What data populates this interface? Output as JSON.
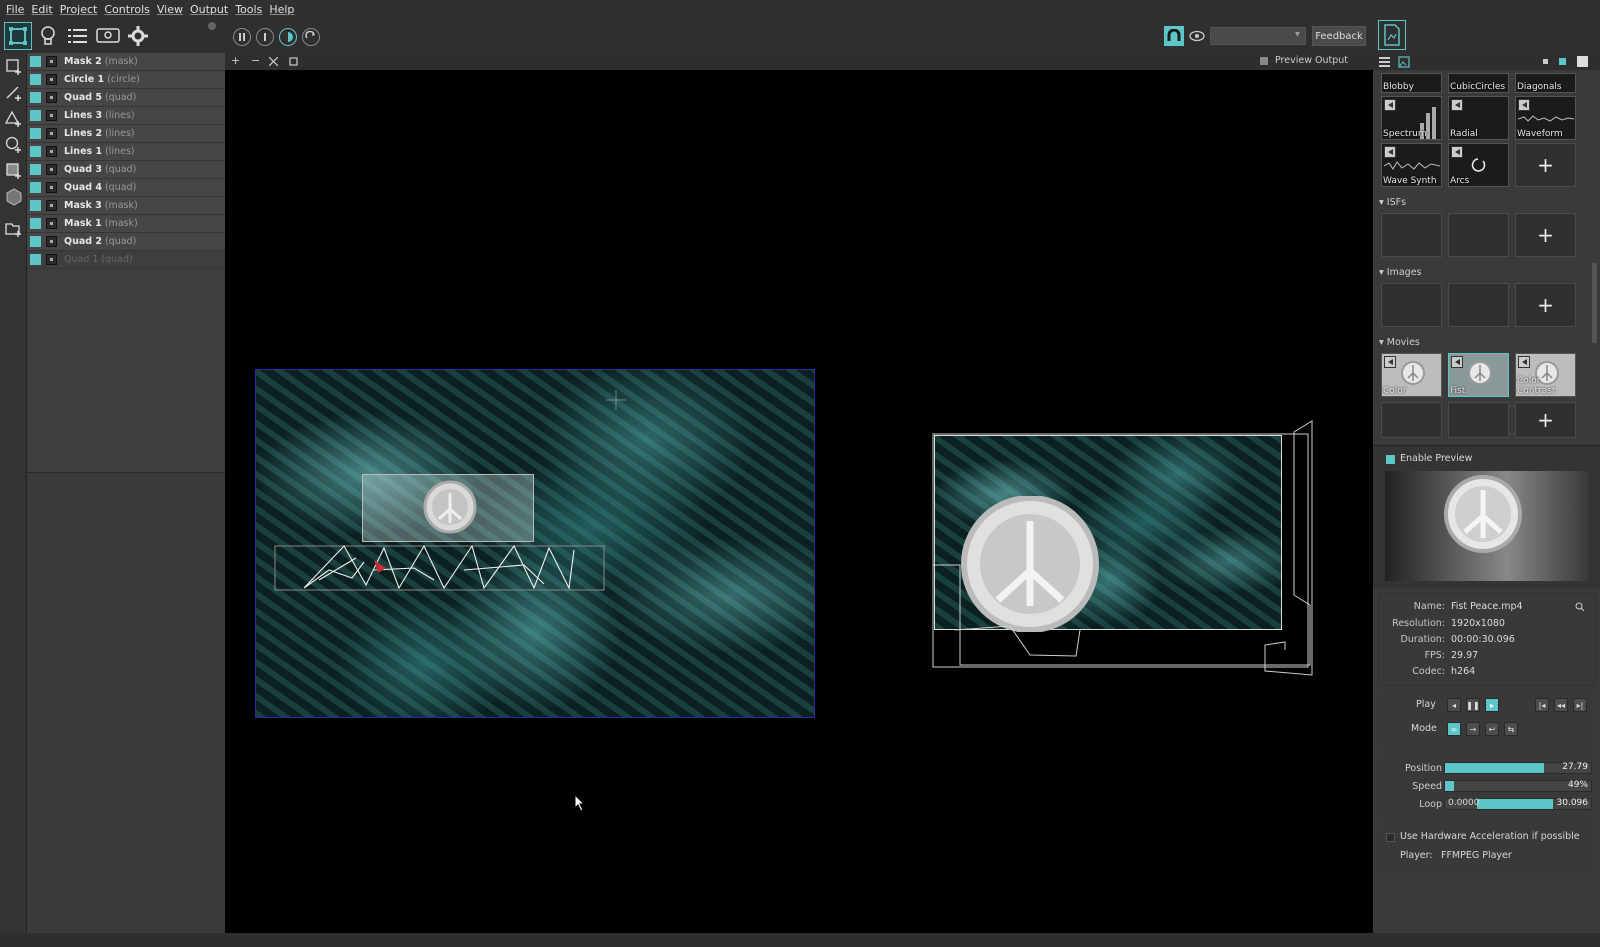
{
  "menu": [
    "File",
    "Edit",
    "Project",
    "Controls",
    "View",
    "Output",
    "Tools",
    "Help"
  ],
  "toolbar": {
    "feedback_label": "Feedback",
    "dropdown_value": ""
  },
  "layers": [
    {
      "name": "Mask 2",
      "type": "(mask)",
      "dim": false
    },
    {
      "name": "Circle 1",
      "type": "(circle)",
      "dim": false
    },
    {
      "name": "Quad 5",
      "type": "(quad)",
      "dim": false
    },
    {
      "name": "Lines 3",
      "type": "(lines)",
      "dim": false
    },
    {
      "name": "Lines 2",
      "type": "(lines)",
      "dim": false
    },
    {
      "name": "Lines 1",
      "type": "(lines)",
      "dim": false
    },
    {
      "name": "Quad 3",
      "type": "(quad)",
      "dim": false
    },
    {
      "name": "Quad 4",
      "type": "(quad)",
      "dim": false
    },
    {
      "name": "Mask 3",
      "type": "(mask)",
      "dim": false
    },
    {
      "name": "Mask 1",
      "type": "(mask)",
      "dim": false
    },
    {
      "name": "Quad 2",
      "type": "(quad)",
      "dim": false
    },
    {
      "name": "Quad 1",
      "type": "(quad)",
      "dim": true
    }
  ],
  "canvas": {
    "preview_output_label": "Preview Output",
    "zoom_in": "+",
    "zoom_out": "−"
  },
  "sources": {
    "generators": [
      "Blobby",
      "CubicCircles",
      "Diagonals",
      "Spectrum",
      "Radial",
      "Waveform",
      "Wave Synth",
      "Arcs"
    ],
    "isfs_label": "ISFs",
    "images_label": "Images",
    "movies_label": "Movies",
    "movies": [
      "Color",
      "Fist",
      "Color Contrast"
    ],
    "plus": "+"
  },
  "preview": {
    "enable_label": "Enable Preview"
  },
  "info": {
    "name_k": "Name:",
    "name_v": "Fist Peace.mp4",
    "res_k": "Resolution:",
    "res_v": "1920x1080",
    "dur_k": "Duration:",
    "dur_v": "00:00:30.096",
    "fps_k": "FPS:",
    "fps_v": "29.97",
    "codec_k": "Codec:",
    "codec_v": "h264"
  },
  "controls": {
    "play_label": "Play",
    "mode_label": "Mode"
  },
  "sliders": {
    "position_label": "Position",
    "position_value": "27.79",
    "position_fraction": 0.68,
    "speed_label": "Speed",
    "speed_value": "49%",
    "speed_fraction": 0.06,
    "loop_label": "Loop",
    "loop_start": "0.0000",
    "loop_end": "30.096"
  },
  "hw": {
    "accel_label": "Use Hardware Acceleration if possible",
    "player_label": "Player:",
    "player_value": "FFMPEG Player"
  },
  "colors": {
    "accent": "#5cc6c8",
    "bg": "#3a3a3a",
    "canvas": "#000000"
  }
}
